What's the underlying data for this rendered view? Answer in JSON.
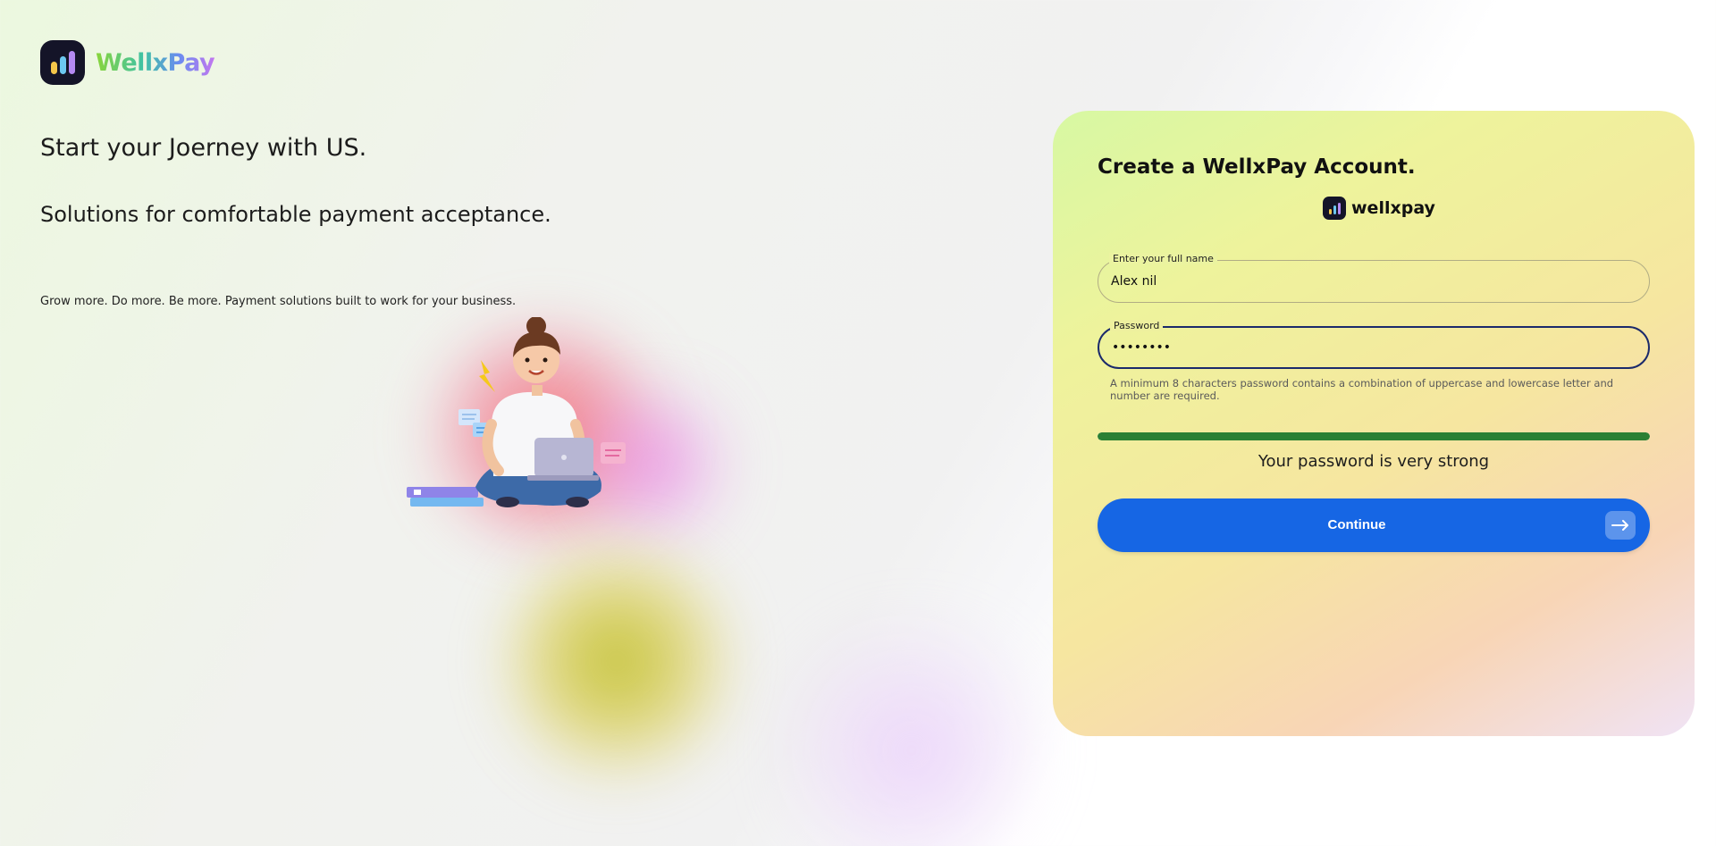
{
  "brand": {
    "name": "WellxPay"
  },
  "hero": {
    "title": "Start your Joerney with US.",
    "subtitle": "Solutions for comfortable payment acceptance.",
    "tagline": "Grow more. Do more. Be more. Payment solutions built to work for your business."
  },
  "card": {
    "title": "Create a WellxPay Account.",
    "brand_small": "wellxpay",
    "name_field": {
      "label": "Enter your full name",
      "value": "Alex nil"
    },
    "password_field": {
      "label": "Password",
      "value": "••••••••"
    },
    "password_hint": "A minimum 8 characters password contains a combination of uppercase and lowercase letter and number are required.",
    "strength": {
      "percent": 100,
      "text": "Your password is very strong",
      "color": "#2a8034"
    },
    "continue_label": "Continue"
  },
  "colors": {
    "accent": "#1666e4",
    "strength": "#2a8034",
    "focus_border": "#1b2a6b"
  }
}
